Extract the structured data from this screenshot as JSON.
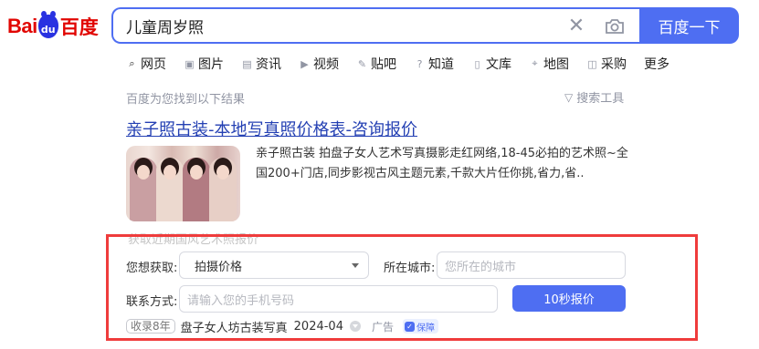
{
  "logo": {
    "text_latin": "Bai",
    "text_paw": "du",
    "text_cn": "百度"
  },
  "search": {
    "query": "儿童周岁照",
    "button_label": "百度一下"
  },
  "tabs": [
    {
      "label": "网页",
      "icon": "search-icon",
      "glyph": "⌕"
    },
    {
      "label": "图片",
      "icon": "image-icon",
      "glyph": "▣"
    },
    {
      "label": "资讯",
      "icon": "news-icon",
      "glyph": "▤"
    },
    {
      "label": "视频",
      "icon": "video-icon",
      "glyph": "▶"
    },
    {
      "label": "贴吧",
      "icon": "tieba-icon",
      "glyph": "✎"
    },
    {
      "label": "知道",
      "icon": "question-icon",
      "glyph": "?"
    },
    {
      "label": "文库",
      "icon": "document-icon",
      "glyph": "▯"
    },
    {
      "label": "地图",
      "icon": "map-icon",
      "glyph": "⌖"
    },
    {
      "label": "采购",
      "icon": "shop-icon",
      "glyph": "◫"
    },
    {
      "label": "更多"
    }
  ],
  "results_info": {
    "count_text": "百度为您找到以下结果",
    "tools_label": "搜索工具"
  },
  "result": {
    "title": "亲子照古装-本地写真照价格表-咨询报价",
    "abstract": "亲子照古装 拍盘子女人艺术写真摄影走红网络,18-45必拍的艺术照~全国200+门店,同步影视古风主题元素,千款大片任你挑,省力,省..",
    "faded_text": "获取近期国风艺术照报价"
  },
  "form": {
    "obtain_label": "您想获取:",
    "obtain_value": "拍摄价格",
    "city_label": "所在城市:",
    "city_placeholder": "您所在的城市",
    "contact_label": "联系方式:",
    "phone_placeholder": "请输入您的手机号码",
    "submit_label": "10秒报价"
  },
  "meta": {
    "years_badge": "收录8年",
    "site_name": "盘子女人坊古装写真",
    "date": "2024-04",
    "ad_label": "广告",
    "guarantee_label": "保障"
  },
  "colors": {
    "brand_blue": "#4e6ef2",
    "link_blue": "#2440b3",
    "brand_red": "#e10602",
    "highlight_frame": "#ef3c3c"
  }
}
